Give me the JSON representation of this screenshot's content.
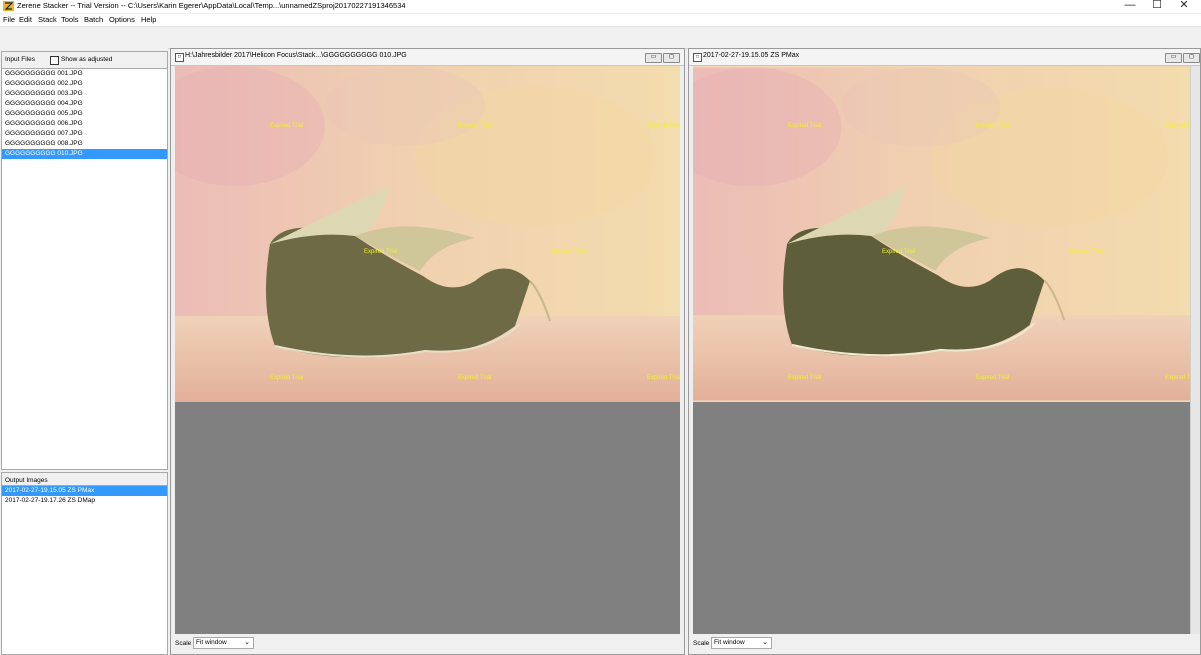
{
  "window": {
    "title": "Zerene Stacker -- Trial Version -- C:\\Users\\Karin Egerer\\AppData\\Local\\Temp...\\unnamedZSproj20170227191346534",
    "minimize": "—",
    "maximize": "☐",
    "close": "✕"
  },
  "menu": [
    "File",
    "Edit",
    "Stack",
    "Tools",
    "Batch",
    "Options",
    "Help"
  ],
  "input_files": {
    "header": "Input Files",
    "show_adjusted_label": "Show as adjusted",
    "items": [
      "GGGGGGGGGG 001.JPG",
      "GGGGGGGGGG 002.JPG",
      "GGGGGGGGGG 003.JPG",
      "GGGGGGGGGG 004.JPG",
      "GGGGGGGGGG 005.JPG",
      "GGGGGGGGGG 006.JPG",
      "GGGGGGGGGG 007.JPG",
      "GGGGGGGGGG 008.JPG",
      "GGGGGGGGGG 010.JPG"
    ],
    "selected_index": 8
  },
  "output_images": {
    "header": "Output Images",
    "items": [
      "2017-02-27-19.15.05 ZS PMax",
      "2017-02-27-19.17.26 ZS DMap"
    ],
    "selected_index": 0
  },
  "left_view": {
    "title": "H:\\Jahresbilder 2017\\Helicon Focus\\Stack...\\GGGGGGGGGG 010.JPG",
    "scale_label": "Scale",
    "scale_value": "Fit window"
  },
  "right_view": {
    "title": "2017-02-27-19.15.05 ZS PMax",
    "scale_label": "Scale",
    "scale_value": "Fit window"
  },
  "watermark_text": "Expired Trial",
  "colors": {
    "selection": "#3399ff",
    "watermark": "#f1ef32",
    "viewport_bg": "#808080"
  }
}
